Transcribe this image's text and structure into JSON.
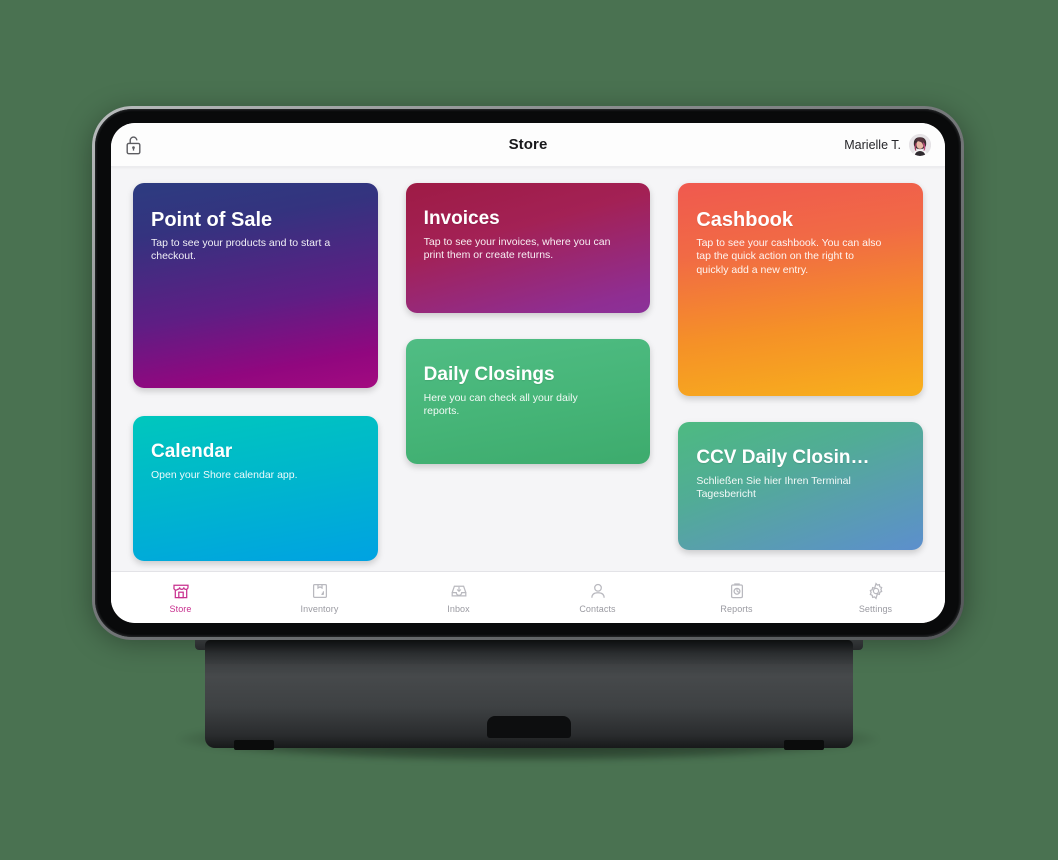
{
  "app": {
    "nav": {
      "lock_icon": "unlocked-padlock-icon",
      "title": "Store",
      "user_name": "Marielle T.",
      "avatar_icon": "user-avatar"
    },
    "tiles": [
      {
        "id": "point-of-sale",
        "title": "Point of Sale",
        "subtitle": "Tap to see your products and to start a checkout.",
        "gradient_from": "#2d3c80",
        "gradient_to": "#a30a80"
      },
      {
        "id": "calendar",
        "title": "Calendar",
        "subtitle": "Open your Shore calendar app.",
        "gradient_from": "#00c7bd",
        "gradient_to": "#00a2e2"
      },
      {
        "id": "invoices",
        "title": "Invoices",
        "subtitle": "Tap to see your invoices, where you can print them or create returns.",
        "gradient_from": "#9e1b45",
        "gradient_to": "#8b3199"
      },
      {
        "id": "daily-closings",
        "title": "Daily Closings",
        "subtitle": "Here you can check all your daily reports.",
        "gradient_from": "#50bd84",
        "gradient_to": "#3dab6d"
      },
      {
        "id": "cashbook",
        "title": "Cashbook",
        "subtitle": "Tap to see your cashbook. You can also tap the quick action on the right to quickly add a new entry.",
        "gradient_from": "#f0594f",
        "gradient_to": "#f8b01c"
      },
      {
        "id": "ccv-daily-closing",
        "title": "CCV Daily Closin…",
        "subtitle": "Schließen Sie hier Ihren Terminal Tagesbericht",
        "gradient_from": "#4dba81",
        "gradient_to": "#5c8fcd"
      }
    ],
    "tabs": [
      {
        "label": "Store",
        "icon": "storefront-icon",
        "active": true
      },
      {
        "label": "Inventory",
        "icon": "box-icon",
        "active": false
      },
      {
        "label": "Inbox",
        "icon": "inbox-tray-icon",
        "active": false
      },
      {
        "label": "Contacts",
        "icon": "person-icon",
        "active": false
      },
      {
        "label": "Reports",
        "icon": "clipboard-chart-icon",
        "active": false
      },
      {
        "label": "Settings",
        "icon": "gear-icon",
        "active": false
      }
    ],
    "colors": {
      "accent": "#c8318f",
      "inactive": "#b9b9bf",
      "background": "#4a7251",
      "screen_bg": "#f5f5f7"
    }
  }
}
